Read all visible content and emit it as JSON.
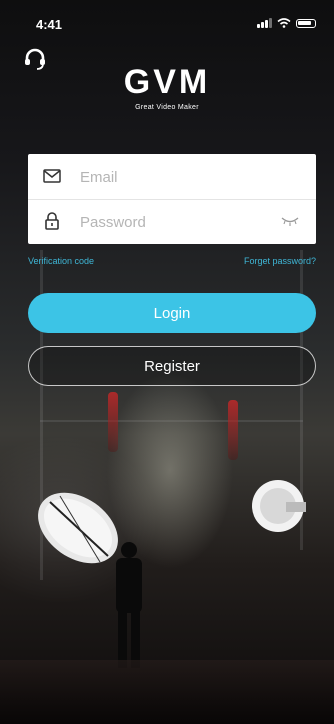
{
  "status_bar": {
    "time": "4:41"
  },
  "logo": {
    "title": "GVM",
    "subtitle": "Great Video Maker"
  },
  "form": {
    "email_placeholder": "Email",
    "password_placeholder": "Password"
  },
  "links": {
    "verification": "Verification code",
    "forgot": "Forget password?"
  },
  "buttons": {
    "login": "Login",
    "register": "Register"
  },
  "colors": {
    "accent": "#3cc4e6",
    "link": "#3fb6d6"
  },
  "icons": [
    "headset-icon",
    "mail-icon",
    "lock-icon",
    "eye-closed-icon",
    "signal-icon",
    "wifi-icon",
    "battery-icon"
  ]
}
